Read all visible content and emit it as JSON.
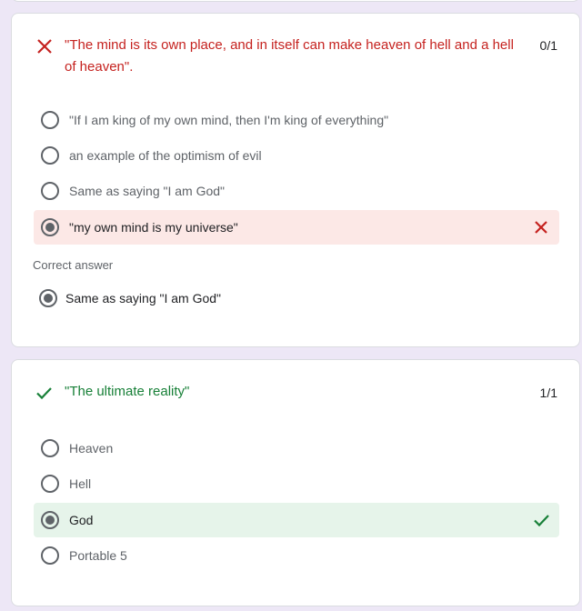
{
  "colors": {
    "background": "#ede7f6",
    "wrong": "#c5221f",
    "right": "#188038",
    "wrong_bg": "#fce8e6",
    "right_bg": "#e6f4ea"
  },
  "question1": {
    "status_icon": "cross-icon",
    "title_line1": "\"The mind is its own place, and in itself can make heaven of hell and a hell",
    "title_line2": "of heaven\".",
    "score": "0/1",
    "options": [
      {
        "label": "\"If I am king of my own mind, then I'm king of everything\"",
        "selected": false
      },
      {
        "label": "an example of the optimism of evil",
        "selected": false
      },
      {
        "label": "Same as saying \"I am God\"",
        "selected": false
      },
      {
        "label": "\"my own mind is my universe\"",
        "selected": true,
        "result": "wrong"
      }
    ],
    "correct_heading": "Correct answer",
    "correct_answer": "Same as saying \"I am God\""
  },
  "question2": {
    "status_icon": "check-icon",
    "title": "\"The ultimate reality\"",
    "score": "1/1",
    "options": [
      {
        "label": "Heaven",
        "selected": false
      },
      {
        "label": "Hell",
        "selected": false
      },
      {
        "label": "God",
        "selected": true,
        "result": "right"
      },
      {
        "label": "Portable 5",
        "selected": false
      }
    ]
  }
}
